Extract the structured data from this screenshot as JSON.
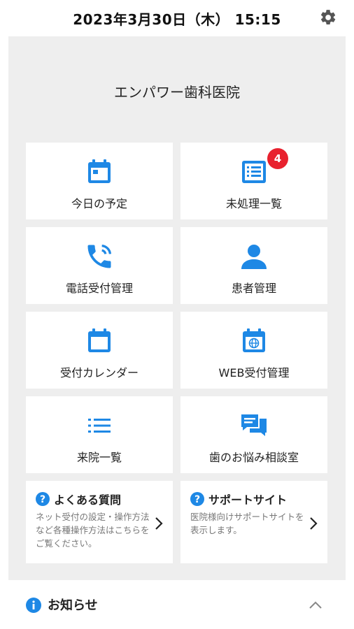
{
  "header": {
    "datetime": "2023年3月30日（木） 15:15"
  },
  "clinic_name": "エンパワー歯科医院",
  "colors": {
    "accent": "#1e88e5",
    "badge": "#e8212e",
    "background": "#eeeeee"
  },
  "menu": [
    {
      "label": "今日の予定",
      "icon": "calendar-icon"
    },
    {
      "label": "未処理一覧",
      "icon": "list-icon",
      "badge": "4"
    },
    {
      "label": "電話受付管理",
      "icon": "phone-icon"
    },
    {
      "label": "患者管理",
      "icon": "person-icon"
    },
    {
      "label": "受付カレンダー",
      "icon": "calendar-blank-icon"
    },
    {
      "label": "WEB受付管理",
      "icon": "web-calendar-icon"
    },
    {
      "label": "来院一覧",
      "icon": "bullet-list-icon"
    },
    {
      "label": "歯のお悩み相談室",
      "icon": "chat-icon"
    }
  ],
  "help": [
    {
      "title": "よくある質問",
      "desc": "ネット受付の設定・操作方法など各種操作方法はこちらをご覧ください。"
    },
    {
      "title": "サポートサイト",
      "desc": "医院様向けサポートサイトを表示します。"
    }
  ],
  "notice": {
    "title": "お知らせ"
  }
}
